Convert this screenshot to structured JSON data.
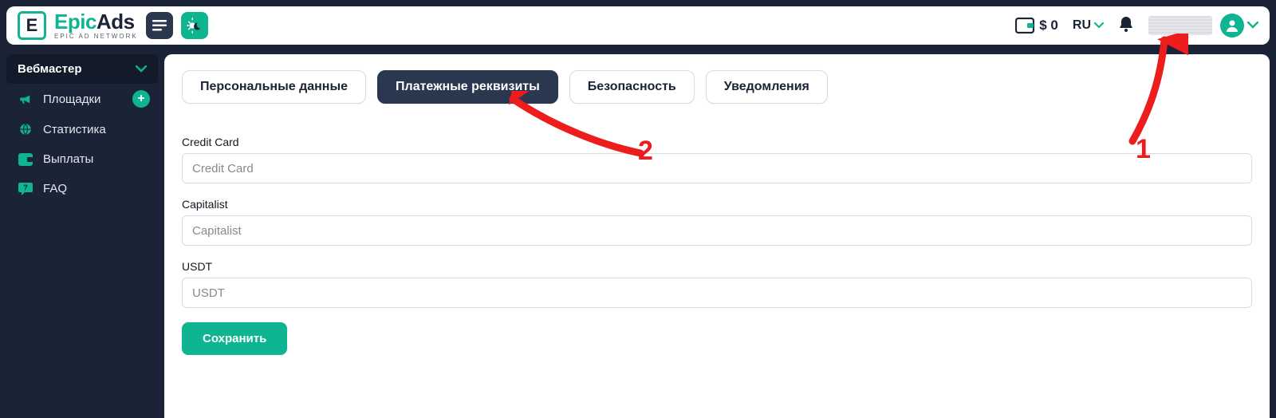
{
  "brand": {
    "name_part1": "Epic",
    "name_part2": "Ads",
    "tagline": "EPIC AD NETWORK",
    "logo_letter": "E"
  },
  "header": {
    "balance": "$ 0",
    "language": "RU"
  },
  "sidebar": {
    "group_label": "Вебмастер",
    "items": [
      {
        "label": "Площадки",
        "icon": "bullhorn",
        "has_add": true
      },
      {
        "label": "Статистика",
        "icon": "globe",
        "has_add": false
      },
      {
        "label": "Выплаты",
        "icon": "wallet",
        "has_add": false
      },
      {
        "label": "FAQ",
        "icon": "chat",
        "has_add": false
      }
    ]
  },
  "tabs": [
    {
      "label": "Персональные данные",
      "active": false
    },
    {
      "label": "Платежные реквизиты",
      "active": true
    },
    {
      "label": "Безопасность",
      "active": false
    },
    {
      "label": "Уведомления",
      "active": false
    }
  ],
  "form": {
    "credit_card": {
      "label": "Credit Card",
      "placeholder": "Credit Card",
      "value": ""
    },
    "capitalist": {
      "label": "Capitalist",
      "placeholder": "Capitalist",
      "value": ""
    },
    "usdt": {
      "label": "USDT",
      "placeholder": "USDT",
      "value": ""
    },
    "save_label": "Сохранить"
  },
  "annotations": {
    "n1": "1",
    "n2": "2"
  }
}
